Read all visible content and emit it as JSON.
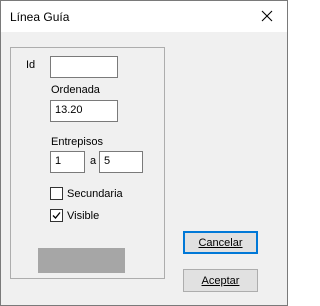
{
  "window": {
    "title": "Línea Guía"
  },
  "group": {
    "id_label": "Id",
    "id_value": "",
    "ordenada_label": "Ordenada",
    "ordenada_value": "13.20",
    "entrepisos_label": "Entrepisos",
    "entrepisos_from": "1",
    "entrepisos_sep": "a",
    "entrepisos_to": "5",
    "secundaria_label": "Secundaria",
    "secundaria_checked": false,
    "visible_label": "Visible",
    "visible_checked": true,
    "color_value": "#a6a6a6"
  },
  "buttons": {
    "cancel": "Cancelar",
    "accept": "Aceptar"
  },
  "icons": {
    "close": "close-icon",
    "check": "checkmark-icon"
  }
}
